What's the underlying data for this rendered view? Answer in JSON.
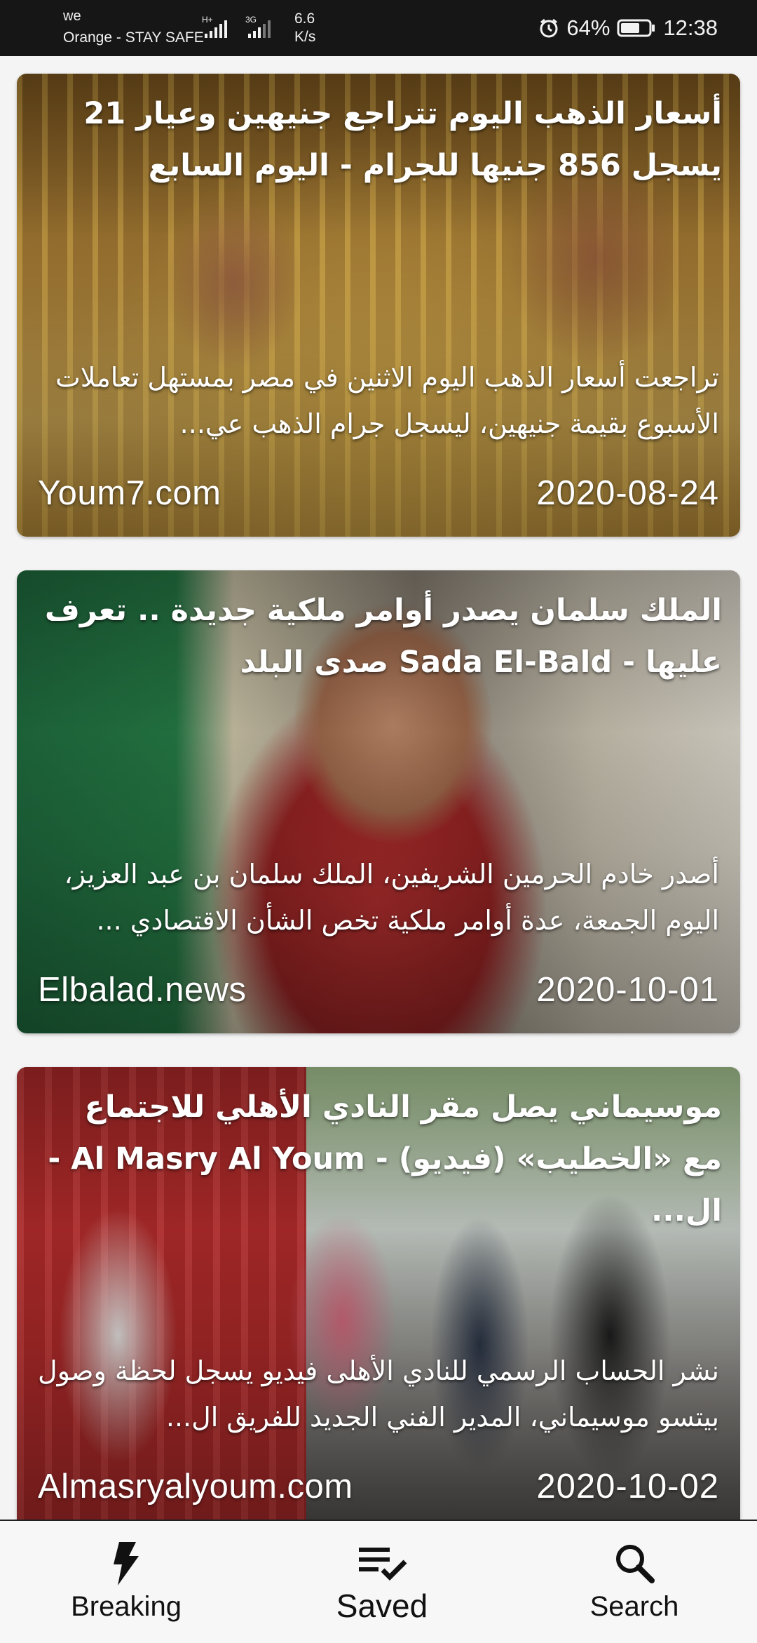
{
  "status_bar": {
    "carrier_top": "we",
    "carrier": "Orange - STAY SAFE",
    "net_type_1": "H+",
    "net_type_2": "3G",
    "speed_value": "6.6",
    "speed_unit": "K/s",
    "battery": "64%",
    "time": "12:38",
    "icons": [
      "signal-icon",
      "signal-icon",
      "alarm-icon",
      "battery-icon"
    ]
  },
  "articles": [
    {
      "title": "أسعار الذهب اليوم تتراجع جنيهين وعيار 21 يسجل 856 جنيها للجرام - اليوم السابع",
      "description": "تراجعت أسعار الذهب اليوم الاثنين في مصر بمستهل تعاملات الأسبوع بقيمة جنيهين، ليسجل جرام الذهب عي...",
      "source": "Youm7.com",
      "date": "2020-08-24"
    },
    {
      "title": "الملك سلمان يصدر أوامر ملكية جديدة .. تعرف عليها - Sada El-Bald صدى البلد",
      "description": "أصدر خادم الحرمين الشريفين، الملك سلمان بن عبد العزيز، اليوم الجمعة، عدة أوامر ملكية تخص الشأن الاقتصادي ...",
      "source": "Elbalad.news",
      "date": "2020-10-01"
    },
    {
      "title": "موسيماني يصل مقر النادي الأهلي للاجتماع مع «الخطيب» (فيديو) - Al Masry Al Youm - ال...",
      "description": "نشر الحساب الرسمي للنادي الأهلى فيديو يسجل لحظة وصول بيتسو موسيماني، المدير الفني الجديد للفريق ال...",
      "source": "Almasryalyoum.com",
      "date": "2020-10-02"
    }
  ],
  "bottom_nav": {
    "items": [
      {
        "label": "Breaking",
        "icon": "lightning-icon",
        "active": false
      },
      {
        "label": "Saved",
        "icon": "saved-list-icon",
        "active": true
      },
      {
        "label": "Search",
        "icon": "search-icon",
        "active": false
      }
    ]
  },
  "colors": {
    "status_bar_bg": "#161616",
    "nav_bg": "#f7f7f7",
    "page_bg": "#f4f4f4",
    "text_on_image": "#ffffff"
  }
}
